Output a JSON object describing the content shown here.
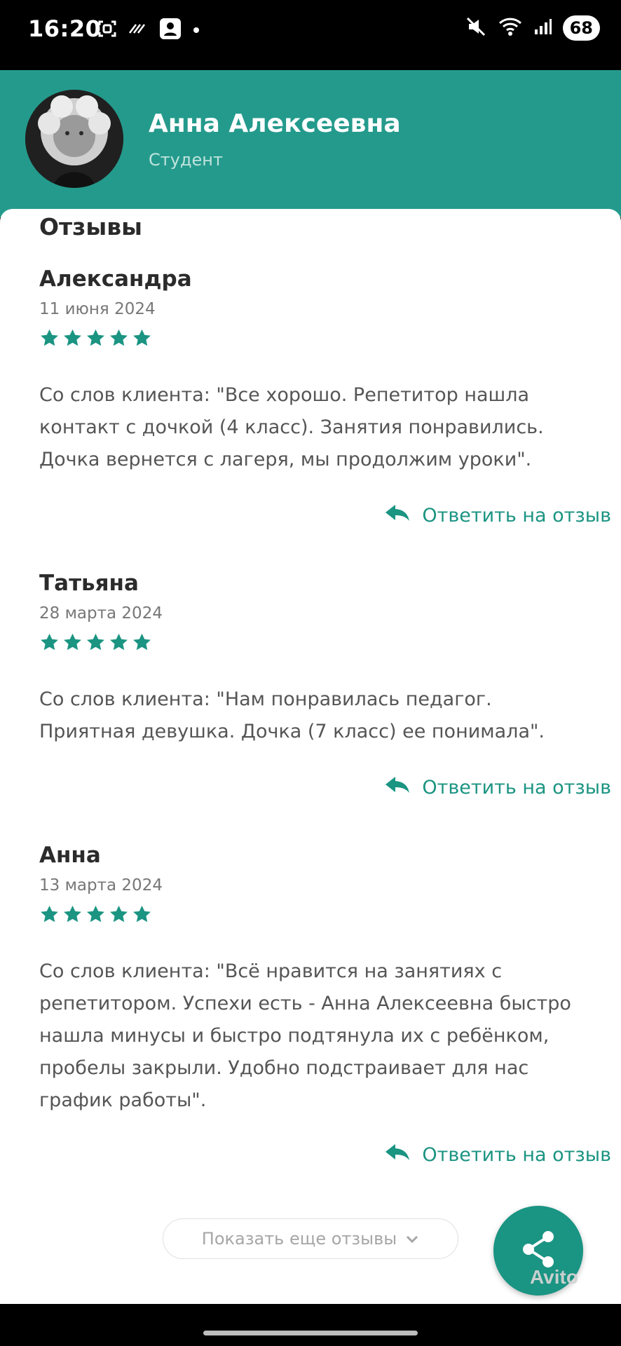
{
  "status_bar": {
    "time": "16:20",
    "battery": "68",
    "icons": [
      "screenshot-icon",
      "nfc-icon",
      "account-icon",
      "notification-dot-icon",
      "mute-icon",
      "wifi-icon",
      "signal-icon"
    ]
  },
  "profile": {
    "name": "Анна Алексеевна",
    "role": "Студент",
    "header_color": "#249a8c"
  },
  "reviews_section": {
    "title": "Отзывы",
    "reply_label": "Ответить на отзыв",
    "show_more_label": "Показать еще отзывы",
    "star_color": "#1b9482",
    "items": [
      {
        "author": "Александра",
        "date": "11 июня 2024",
        "rating": 5,
        "text": "Со слов клиента: \"Все хорошо. Репетитор нашла контакт с дочкой (4 класс). Занятия понравились. Дочка вернется с лагеря, мы продолжим уроки\"."
      },
      {
        "author": "Татьяна",
        "date": "28 марта 2024",
        "rating": 5,
        "text": "Со слов клиента: \"Нам понравилась педагог. Приятная девушка. Дочка (7 класс) ее понимала\"."
      },
      {
        "author": "Анна",
        "date": "13 марта 2024",
        "rating": 5,
        "text": "Со слов клиента: \"Всё нравится на занятиях с репетитором. Успехи есть - Анна Алексеевна быстро нашла минусы и быстро подтянула их с ребёнком, пробелы закрыли. Удобно подстраивает для нас график работы\"."
      }
    ]
  },
  "fab": {
    "icon": "share-icon"
  },
  "watermark": "Avito"
}
